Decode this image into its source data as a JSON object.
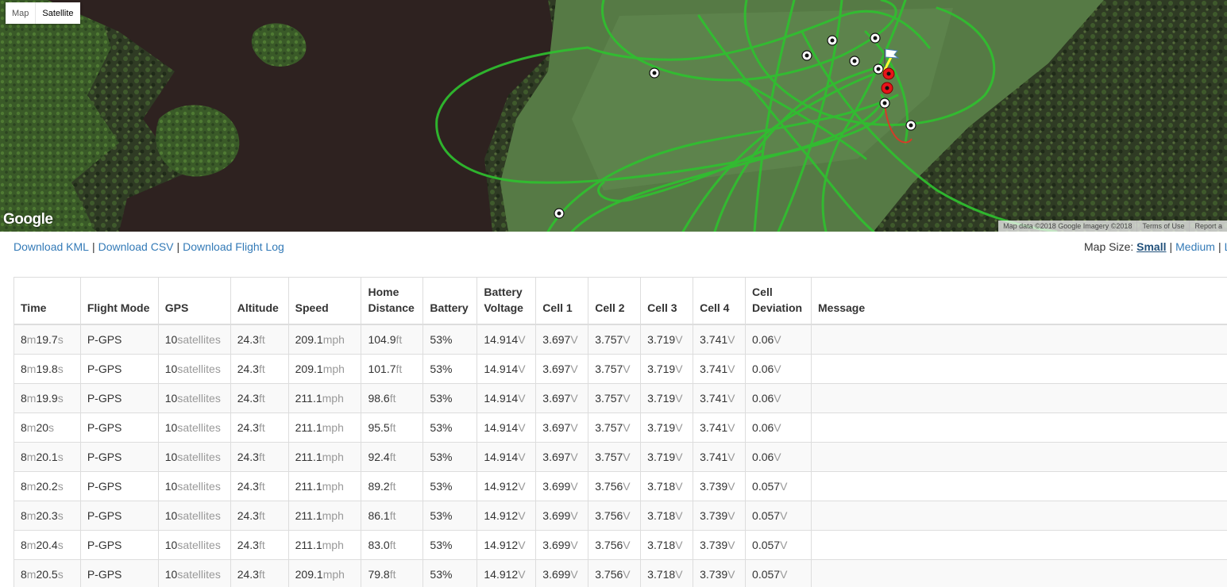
{
  "map": {
    "type_buttons": [
      {
        "label": "Map",
        "active": false
      },
      {
        "label": "Satellite",
        "active": true
      }
    ],
    "logo": "Google",
    "attribution": [
      "Map data ©2018 Google Imagery ©2018",
      "Terms of Use",
      "Report a"
    ],
    "colors": {
      "flight_path": "#2fc02f",
      "home_path": "#d63a2a",
      "marker": "#e8141a"
    }
  },
  "links": {
    "download_kml": "Download KML",
    "download_csv": "Download CSV",
    "download_flight_log": "Download Flight Log",
    "separator": "|"
  },
  "map_size": {
    "label": "Map Size:",
    "options": [
      "Small",
      "Medium",
      "L"
    ],
    "current": "Small"
  },
  "table": {
    "headers": [
      {
        "line1": "",
        "line2": "Time"
      },
      {
        "line1": "",
        "line2": "Flight Mode"
      },
      {
        "line1": "",
        "line2": "GPS"
      },
      {
        "line1": "",
        "line2": "Altitude"
      },
      {
        "line1": "",
        "line2": "Speed"
      },
      {
        "line1": "Home",
        "line2": "Distance"
      },
      {
        "line1": "",
        "line2": "Battery"
      },
      {
        "line1": "Battery",
        "line2": "Voltage"
      },
      {
        "line1": "",
        "line2": "Cell 1"
      },
      {
        "line1": "",
        "line2": "Cell 2"
      },
      {
        "line1": "",
        "line2": "Cell 3"
      },
      {
        "line1": "",
        "line2": "Cell 4"
      },
      {
        "line1": "Cell",
        "line2": "Deviation"
      },
      {
        "line1": "",
        "line2": "Message"
      }
    ],
    "rows": [
      {
        "min": "8",
        "min_u": "m",
        "sec": "19.7",
        "sec_u": "s",
        "mode": "P-GPS",
        "sats": "10",
        "sats_u": "satellites",
        "alt": "24.3",
        "alt_u": "ft",
        "speed": "209.1",
        "speed_u": "mph",
        "home": "104.9",
        "home_u": "ft",
        "battery": "53%",
        "volt": "14.914",
        "volt_u": "V",
        "c1": "3.697",
        "c2": "3.757",
        "c3": "3.719",
        "c4": "3.741",
        "cell_u": "V",
        "dev": "0.06",
        "dev_u": "V",
        "msg": ""
      },
      {
        "min": "8",
        "min_u": "m",
        "sec": "19.8",
        "sec_u": "s",
        "mode": "P-GPS",
        "sats": "10",
        "sats_u": "satellites",
        "alt": "24.3",
        "alt_u": "ft",
        "speed": "209.1",
        "speed_u": "mph",
        "home": "101.7",
        "home_u": "ft",
        "battery": "53%",
        "volt": "14.914",
        "volt_u": "V",
        "c1": "3.697",
        "c2": "3.757",
        "c3": "3.719",
        "c4": "3.741",
        "cell_u": "V",
        "dev": "0.06",
        "dev_u": "V",
        "msg": ""
      },
      {
        "min": "8",
        "min_u": "m",
        "sec": "19.9",
        "sec_u": "s",
        "mode": "P-GPS",
        "sats": "10",
        "sats_u": "satellites",
        "alt": "24.3",
        "alt_u": "ft",
        "speed": "211.1",
        "speed_u": "mph",
        "home": "98.6",
        "home_u": "ft",
        "battery": "53%",
        "volt": "14.914",
        "volt_u": "V",
        "c1": "3.697",
        "c2": "3.757",
        "c3": "3.719",
        "c4": "3.741",
        "cell_u": "V",
        "dev": "0.06",
        "dev_u": "V",
        "msg": ""
      },
      {
        "min": "8",
        "min_u": "m",
        "sec": "20",
        "sec_u": "s",
        "mode": "P-GPS",
        "sats": "10",
        "sats_u": "satellites",
        "alt": "24.3",
        "alt_u": "ft",
        "speed": "211.1",
        "speed_u": "mph",
        "home": "95.5",
        "home_u": "ft",
        "battery": "53%",
        "volt": "14.914",
        "volt_u": "V",
        "c1": "3.697",
        "c2": "3.757",
        "c3": "3.719",
        "c4": "3.741",
        "cell_u": "V",
        "dev": "0.06",
        "dev_u": "V",
        "msg": ""
      },
      {
        "min": "8",
        "min_u": "m",
        "sec": "20.1",
        "sec_u": "s",
        "mode": "P-GPS",
        "sats": "10",
        "sats_u": "satellites",
        "alt": "24.3",
        "alt_u": "ft",
        "speed": "211.1",
        "speed_u": "mph",
        "home": "92.4",
        "home_u": "ft",
        "battery": "53%",
        "volt": "14.914",
        "volt_u": "V",
        "c1": "3.697",
        "c2": "3.757",
        "c3": "3.719",
        "c4": "3.741",
        "cell_u": "V",
        "dev": "0.06",
        "dev_u": "V",
        "msg": ""
      },
      {
        "min": "8",
        "min_u": "m",
        "sec": "20.2",
        "sec_u": "s",
        "mode": "P-GPS",
        "sats": "10",
        "sats_u": "satellites",
        "alt": "24.3",
        "alt_u": "ft",
        "speed": "211.1",
        "speed_u": "mph",
        "home": "89.2",
        "home_u": "ft",
        "battery": "53%",
        "volt": "14.912",
        "volt_u": "V",
        "c1": "3.699",
        "c2": "3.756",
        "c3": "3.718",
        "c4": "3.739",
        "cell_u": "V",
        "dev": "0.057",
        "dev_u": "V",
        "msg": ""
      },
      {
        "min": "8",
        "min_u": "m",
        "sec": "20.3",
        "sec_u": "s",
        "mode": "P-GPS",
        "sats": "10",
        "sats_u": "satellites",
        "alt": "24.3",
        "alt_u": "ft",
        "speed": "211.1",
        "speed_u": "mph",
        "home": "86.1",
        "home_u": "ft",
        "battery": "53%",
        "volt": "14.912",
        "volt_u": "V",
        "c1": "3.699",
        "c2": "3.756",
        "c3": "3.718",
        "c4": "3.739",
        "cell_u": "V",
        "dev": "0.057",
        "dev_u": "V",
        "msg": ""
      },
      {
        "min": "8",
        "min_u": "m",
        "sec": "20.4",
        "sec_u": "s",
        "mode": "P-GPS",
        "sats": "10",
        "sats_u": "satellites",
        "alt": "24.3",
        "alt_u": "ft",
        "speed": "211.1",
        "speed_u": "mph",
        "home": "83.0",
        "home_u": "ft",
        "battery": "53%",
        "volt": "14.912",
        "volt_u": "V",
        "c1": "3.699",
        "c2": "3.756",
        "c3": "3.718",
        "c4": "3.739",
        "cell_u": "V",
        "dev": "0.057",
        "dev_u": "V",
        "msg": ""
      },
      {
        "min": "8",
        "min_u": "m",
        "sec": "20.5",
        "sec_u": "s",
        "mode": "P-GPS",
        "sats": "10",
        "sats_u": "satellites",
        "alt": "24.3",
        "alt_u": "ft",
        "speed": "209.1",
        "speed_u": "mph",
        "home": "79.8",
        "home_u": "ft",
        "battery": "53%",
        "volt": "14.912",
        "volt_u": "V",
        "c1": "3.699",
        "c2": "3.756",
        "c3": "3.718",
        "c4": "3.739",
        "cell_u": "V",
        "dev": "0.057",
        "dev_u": "V",
        "msg": ""
      }
    ]
  }
}
